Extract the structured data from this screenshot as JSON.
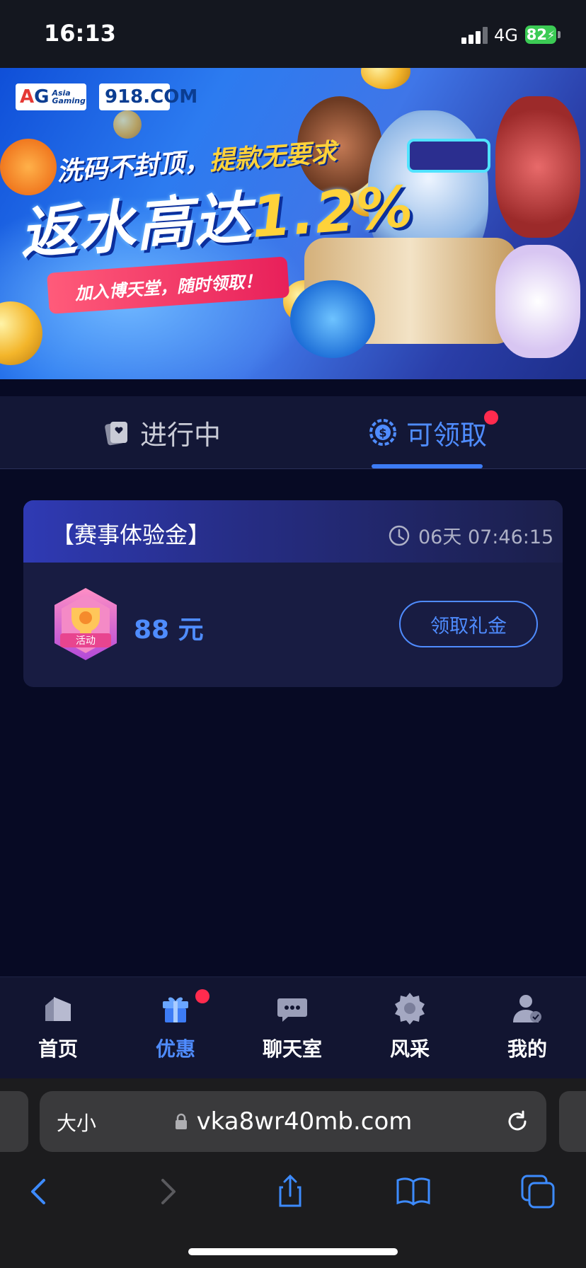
{
  "status_bar": {
    "time": "16:13",
    "network": "4G",
    "battery": "82"
  },
  "banner": {
    "logo_ag": "AG",
    "logo_ag_sub": "Asia Gaming",
    "logo_918": "918.COM",
    "line1_a": "洗码不封顶，",
    "line1_b": "提款无要求",
    "headline_a": "返水高达",
    "headline_b": "1.2%",
    "cta": "加入博天堂，随时领取！"
  },
  "tabs": [
    {
      "label": "进行中",
      "icon": "cards-icon",
      "active": false
    },
    {
      "label": "可领取",
      "icon": "dollar-chip-icon",
      "active": true,
      "badge": true
    }
  ],
  "card": {
    "title": "【赛事体验金】",
    "countdown": "06天 07:46:15",
    "badge_text": "活动",
    "amount": "88 元",
    "button": "领取礼金"
  },
  "bottom_nav": [
    {
      "label": "首页",
      "icon": "home-icon"
    },
    {
      "label": "优惠",
      "icon": "gift-icon",
      "active": true,
      "badge": true
    },
    {
      "label": "聊天室",
      "icon": "chat-icon"
    },
    {
      "label": "风采",
      "icon": "badge-icon"
    },
    {
      "label": "我的",
      "icon": "user-icon"
    }
  ],
  "browser": {
    "text_size": "大小",
    "url": "vka8wr40mb.com"
  },
  "colors": {
    "accent": "#4f8cff",
    "background": "#070a24",
    "badge": "#ff2b4e"
  }
}
